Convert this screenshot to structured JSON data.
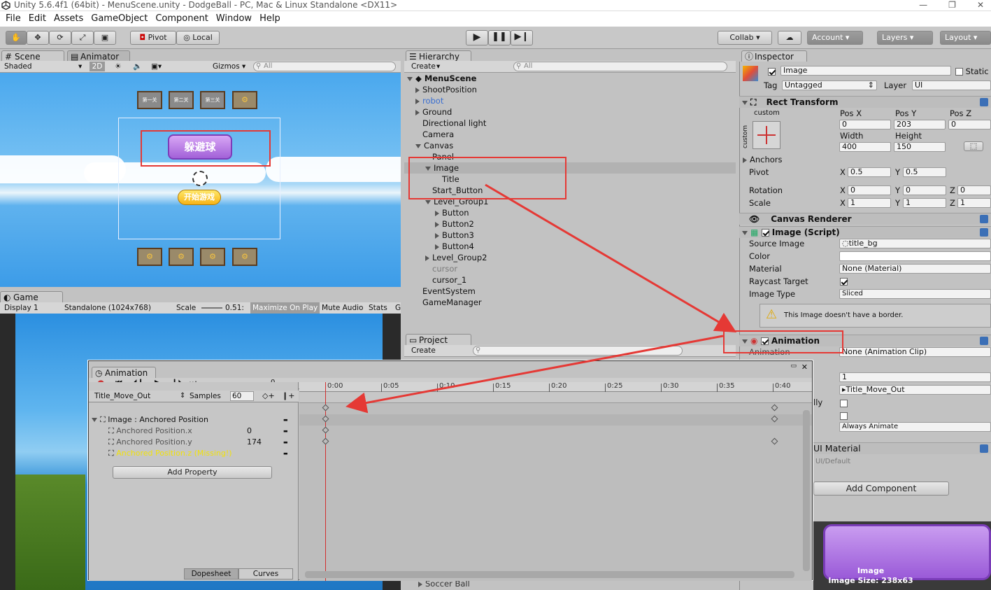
{
  "window": {
    "title": "Unity 5.6.4f1 (64bit) - MenuScene.unity - DodgeBall - PC, Mac & Linux Standalone <DX11>"
  },
  "menu": [
    "File",
    "Edit",
    "Assets",
    "GameObject",
    "Component",
    "Window",
    "Help"
  ],
  "toolbar": {
    "pivot": "Pivot",
    "local": "Local",
    "collab": "Collab ▾",
    "account": "Account",
    "layers": "Layers",
    "layout": "Layout"
  },
  "scene": {
    "tab": "Scene",
    "animator_tab": "Animator",
    "shading": "Shaded",
    "mode_2d": "2D",
    "gizmos": "Gizmos",
    "search_placeholder": "All"
  },
  "game": {
    "tab": "Game",
    "display": "Display 1",
    "resolution": "Standalone (1024x768)",
    "scale_label": "Scale",
    "scale_value": "0.51:",
    "maximize": "Maximize On Play",
    "mute": "Mute Audio",
    "stats": "Stats",
    "gizmos_short": "G"
  },
  "hierarchy": {
    "tab": "Hierarchy",
    "create": "Create",
    "search_placeholder": "All",
    "scene_name": "MenuScene",
    "items": [
      {
        "label": "ShootPosition",
        "exp": "r"
      },
      {
        "label": "robot",
        "exp": "r",
        "color": "#3b6fd1"
      },
      {
        "label": "Ground",
        "exp": "r"
      },
      {
        "label": "Directional light",
        "exp": ""
      },
      {
        "label": "Camera",
        "exp": ""
      },
      {
        "label": "Canvas",
        "exp": "d"
      },
      {
        "label": "Panel",
        "exp": ""
      },
      {
        "label": "Image",
        "exp": "d"
      },
      {
        "label": "Title",
        "exp": ""
      },
      {
        "label": "Start_Button",
        "exp": ""
      },
      {
        "label": "Level_Group1",
        "exp": "d"
      },
      {
        "label": "Button",
        "exp": "r"
      },
      {
        "label": "Button2",
        "exp": "r"
      },
      {
        "label": "Button3",
        "exp": "r"
      },
      {
        "label": "Button4",
        "exp": "r"
      },
      {
        "label": "Level_Group2",
        "exp": "r"
      },
      {
        "label": "cursor",
        "exp": "",
        "color": "#7a7a7a"
      },
      {
        "label": "cursor_1",
        "exp": ""
      },
      {
        "label": "EventSystem",
        "exp": ""
      },
      {
        "label": "GameManager",
        "exp": ""
      }
    ]
  },
  "project": {
    "tab": "Project",
    "create": "Create",
    "soccer": "Soccer Ball"
  },
  "inspector": {
    "tab": "Inspector",
    "name": "Image",
    "static": "Static",
    "tag_label": "Tag",
    "tag": "Untagged",
    "layer_label": "Layer",
    "layer": "UI",
    "rect": {
      "title": "Rect Transform",
      "anchor_preset": "custom",
      "side_label": "custom",
      "pos_x_label": "Pos X",
      "pos_y_label": "Pos Y",
      "pos_z_label": "Pos Z",
      "pos_x": "0",
      "pos_y": "203",
      "pos_z": "0",
      "width_label": "Width",
      "height_label": "Height",
      "width": "400",
      "height": "150",
      "anchors": "Anchors",
      "pivot": "Pivot",
      "pivot_x": "0.5",
      "pivot_y": "0.5",
      "rotation": "Rotation",
      "rot_x": "0",
      "rot_y": "0",
      "rot_z": "0",
      "scale": "Scale",
      "sc_x": "1",
      "sc_y": "1",
      "sc_z": "1",
      "x": "X",
      "y": "Y",
      "z": "Z"
    },
    "canvas_renderer": "Canvas Renderer",
    "image_script": {
      "title": "Image (Script)",
      "source_label": "Source Image",
      "source": "title_bg",
      "color_label": "Color",
      "material_label": "Material",
      "material": "None (Material)",
      "raycast_label": "Raycast Target",
      "type_label": "Image Type",
      "type": "Sliced",
      "warning": "This Image doesn't have a border."
    },
    "animation": {
      "title": "Animation",
      "clip_label": "Animation",
      "clip": "None (Animation Clip)",
      "size": "1",
      "element": "Title_Move_Out",
      "lly": "lly",
      "culling": "Always Animate"
    },
    "ui_material": "UI Material",
    "ui_default": "UI/Default",
    "add_component": "Add Component",
    "preview": {
      "name": "Image",
      "size": "Image Size: 238x63"
    }
  },
  "animation_window": {
    "tab": "Animation",
    "frame": "0",
    "clip": "Title_Move_Out",
    "samples_label": "Samples",
    "samples": "60",
    "ticks": [
      "0:00",
      "0:05",
      "0:10",
      "0:15",
      "0:20",
      "0:25",
      "0:30",
      "0:35",
      "0:40"
    ],
    "properties": [
      {
        "label": "Image : Anchored Position",
        "value": "",
        "missing": false,
        "group": true
      },
      {
        "label": "Anchored Position.x",
        "value": "0",
        "missing": false,
        "group": false
      },
      {
        "label": "Anchored Position.y",
        "value": "174",
        "missing": false,
        "group": false
      },
      {
        "label": "Anchored Position.z (Missing!)",
        "value": "",
        "missing": true,
        "group": false
      }
    ],
    "add_property": "Add Property",
    "dopesheet": "Dopesheet",
    "curves": "Curves"
  },
  "scene_text": {
    "title_button": "躲避球",
    "start_button": "开始游戏",
    "level_labels": [
      "第一关",
      "第二关",
      "第三关"
    ]
  },
  "colors": {
    "annotation": "#e53935",
    "missing": "#f2e20a",
    "timeline_cursor": "#d32f2f"
  }
}
